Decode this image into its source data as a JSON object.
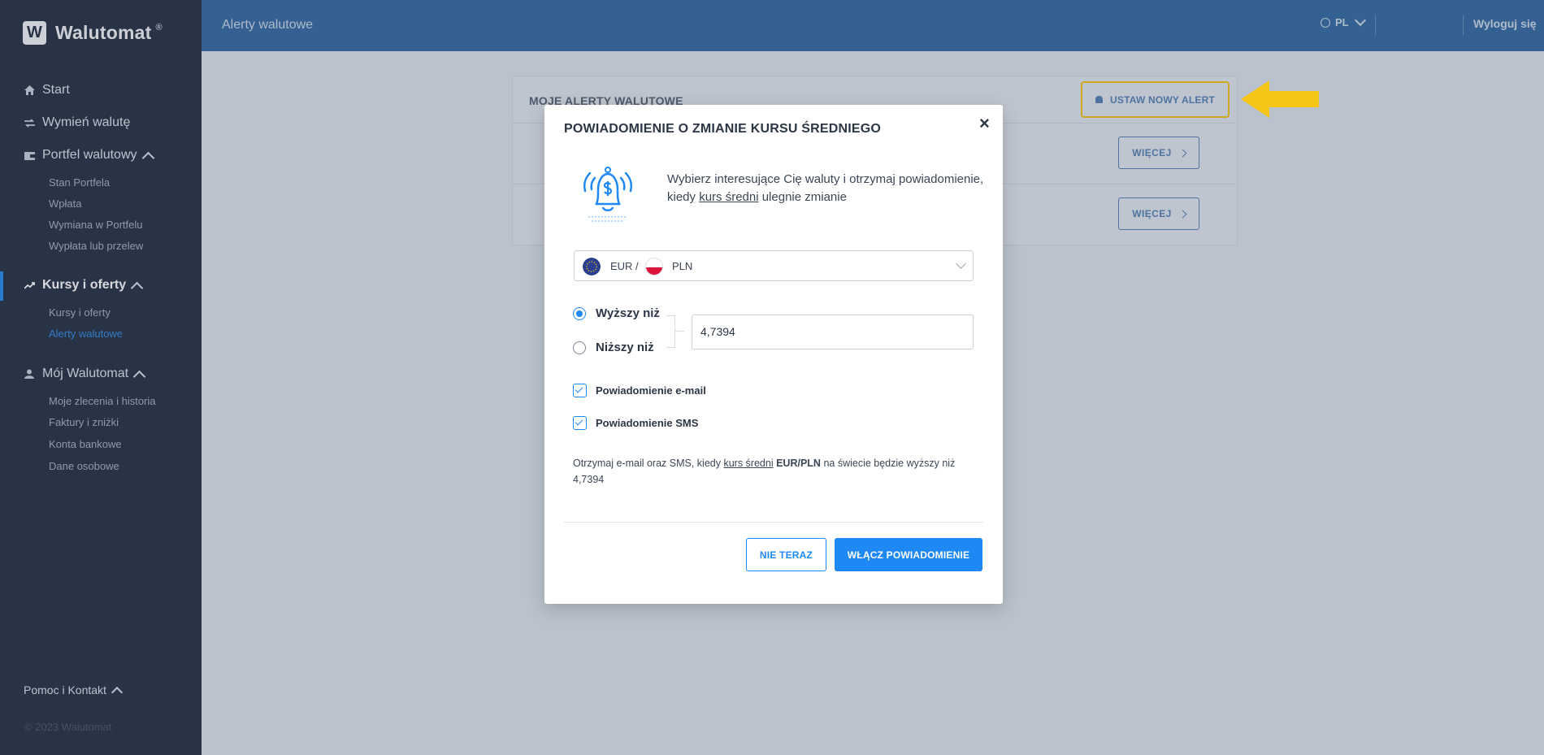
{
  "app": {
    "name": "Walutomat",
    "reg": "®",
    "logo_letter": "W"
  },
  "sidebar": {
    "items": [
      {
        "label": "Start",
        "icon": "home-icon"
      },
      {
        "label": "Wymień walutę",
        "icon": "exchange-icon"
      },
      {
        "label": "Portfel walutowy",
        "icon": "wallet-icon"
      },
      {
        "label": "Kursy i oferty",
        "icon": "trend-icon"
      },
      {
        "label": "Mój Walutomat",
        "icon": "user-icon"
      }
    ],
    "portfel_sub": [
      "Stan Portfela",
      "Wpłata",
      "Wymiana w Portfelu",
      "Wypłata lub przelew"
    ],
    "kursy_sub": [
      "Kursy i oferty",
      "Alerty walutowe"
    ],
    "moj_sub": [
      "Moje zlecenia i historia",
      "Faktury i zniżki",
      "Konta bankowe",
      "Dane osobowe"
    ],
    "help": "Pomoc i Kontakt",
    "copyright": "© 2023 Walutomat"
  },
  "topbar": {
    "title": "Alerty walutowe",
    "lang": "PL",
    "logout": "Wyloguj się"
  },
  "background": {
    "panel_title": "MOJE ALERTY WALUTOWE",
    "new_alert": "USTAW NOWY ALERT",
    "more": "WIĘCEJ"
  },
  "modal": {
    "title": "POWIADOMIENIE O ZMIANIE KURSU ŚREDNIEGO",
    "close": "×",
    "desc_1": "Wybierz interesujące Cię waluty i otrzymaj powiadomienie, kiedy ",
    "desc_link": "kurs średni",
    "desc_2": " ulegnie zmianie",
    "currency_from": "EUR",
    "currency_sep": "/",
    "currency_to": "PLN",
    "radio_above": "Wyższy niż",
    "radio_below": "Niższy niż",
    "value": "4,7394",
    "check_email": "Powiadomienie e-mail",
    "check_sms": "Powiadomienie SMS",
    "summary_1": "Otrzymaj e-mail oraz SMS, kiedy ",
    "summary_link": "kurs średni",
    "summary_pair": "EUR/PLN",
    "summary_2": " na świecie będzie wyższy niż ",
    "summary_value": "4,7394",
    "btn_not_now": "NIE TERAZ",
    "btn_enable": "WŁĄCZ POWIADOMIENIE"
  },
  "colors": {
    "accent": "#1e88f5",
    "sidebar": "#2b3649",
    "topbar": "#3a6ea5",
    "highlight": "#f5c518"
  }
}
